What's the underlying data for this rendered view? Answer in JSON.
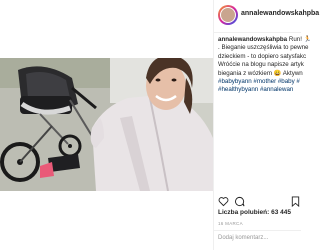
{
  "post": {
    "username": "annalewandowskahpba",
    "caption": {
      "username": "annalewandowskahpba",
      "lines": [
        "Run! 🏃",
        ". Bieganie uszczęśliwia to pewne",
        "dzieckiem - to dopiero satysfakc",
        "Wróćcie na blogu napisze artyk",
        "biegania z wózkiem 😀 Aktywn",
        "#babybyann #mother #baby #"
      ],
      "hashtags_line": "#healthybyann #annalewan"
    },
    "likes_label": "Liczba polubień: 63 445",
    "date": "16 MARCA",
    "comment_placeholder": "Dodaj komentarz..."
  },
  "icons": {
    "heart": "heart-icon",
    "comment": "comment-icon",
    "share": "share-icon",
    "save": "bookmark-icon"
  }
}
